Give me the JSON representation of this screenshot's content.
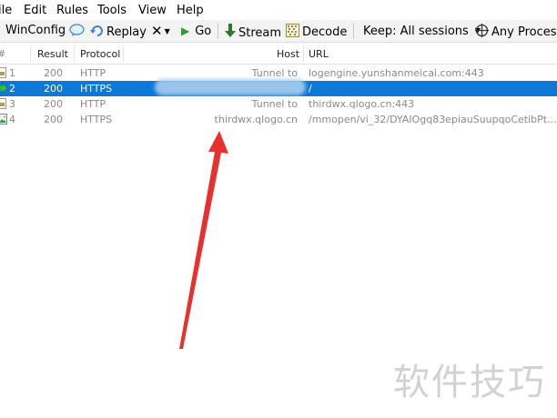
{
  "menu": [
    "ile",
    "Edit",
    "Rules",
    "Tools",
    "View",
    "Help"
  ],
  "toolbar": {
    "winconfig": "WinConfig",
    "replay": "Replay",
    "go": "Go",
    "stream": "Stream",
    "decode": "Decode",
    "keep": "Keep: All sessions",
    "process": "Any Process"
  },
  "columns": {
    "num": "#",
    "result": "Result",
    "protocol": "Protocol",
    "host": "Host",
    "url": "URL"
  },
  "sessions": [
    {
      "num": "1",
      "result": "200",
      "protocol": "HTTP",
      "host": "Tunnel to",
      "url": "logengine.yunshanmeicai.com:443",
      "selected": false
    },
    {
      "num": "2",
      "result": "200",
      "protocol": "HTTPS",
      "host": "",
      "url": "/",
      "selected": true
    },
    {
      "num": "3",
      "result": "200",
      "protocol": "HTTP",
      "host": "Tunnel to",
      "url": "thirdwx.qlogo.cn:443",
      "selected": false
    },
    {
      "num": "4",
      "result": "200",
      "protocol": "HTTPS",
      "host": "thirdwx.qlogo.cn",
      "url": "/mmopen/vi_32/DYAIOgq83epiauSuupqoCetibPt...",
      "selected": false
    }
  ],
  "watermark": "软件技巧",
  "colors": {
    "selection": "#0d78d6",
    "arrow": "#e8302e",
    "toolbar_bg": "#f3f3f3"
  }
}
